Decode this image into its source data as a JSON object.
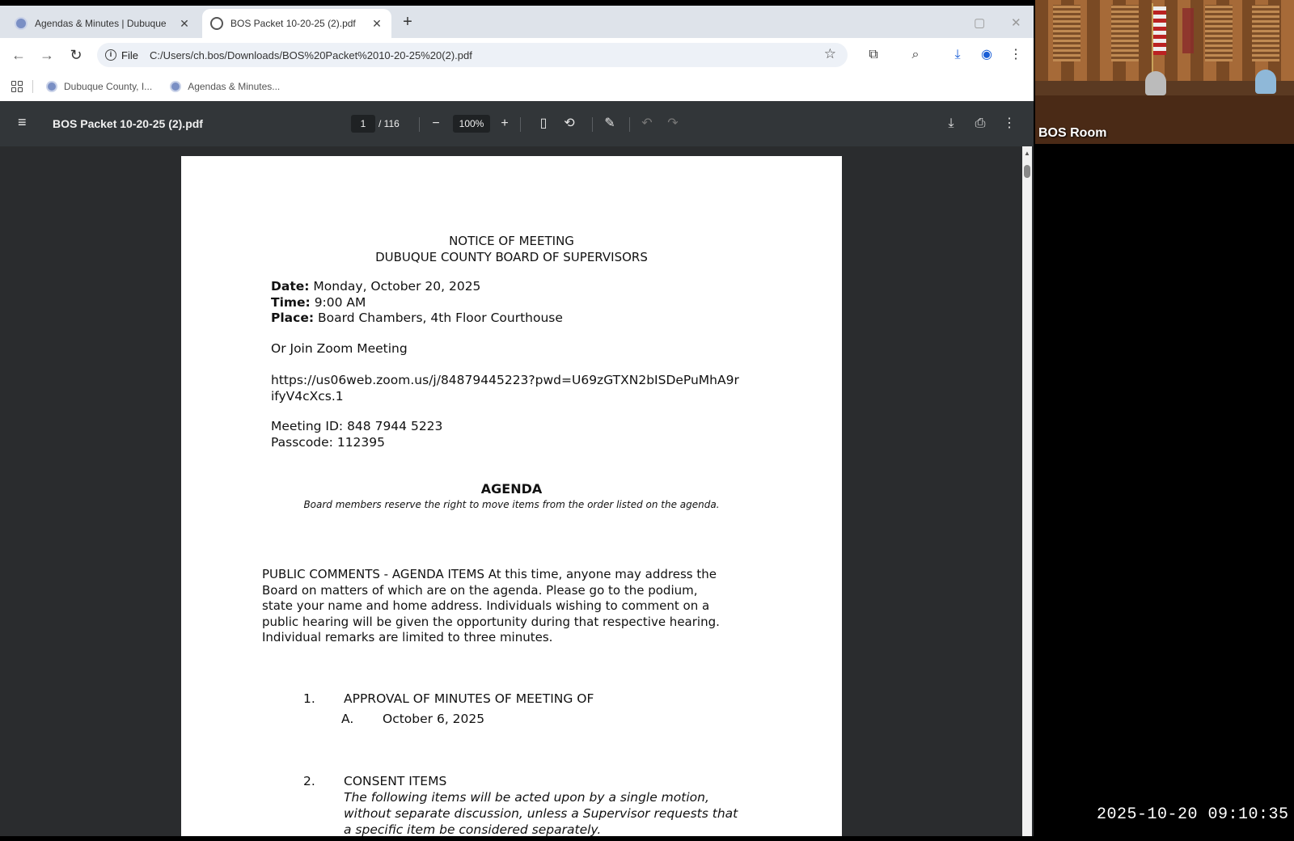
{
  "tabs": [
    {
      "title": "Agendas & Minutes | Dubuque",
      "close": "✕"
    },
    {
      "title": "BOS Packet 10-20-25 (2).pdf",
      "close": "✕"
    }
  ],
  "newtab": "+",
  "window": {
    "minimize": "▢",
    "close": "✕"
  },
  "nav": {
    "back": "←",
    "forward": "→",
    "reload": "↻"
  },
  "omnibox": {
    "info": "i",
    "scheme": "File",
    "url": "C:/Users/ch.bos/Downloads/BOS%20Packet%2010-20-25%20(2).pdf",
    "star": "☆"
  },
  "toolbar_icons": {
    "extensions": "⧉",
    "lens": "⌕",
    "download": "⤓",
    "profile": "◉",
    "menu": "⋮"
  },
  "bookmarks": [
    {
      "label": "Dubuque County, I..."
    },
    {
      "label": "Agendas & Minutes..."
    }
  ],
  "pdf": {
    "menu": "≡",
    "filename": "BOS Packet 10-20-25 (2).pdf",
    "page": "1",
    "total": "/ 116",
    "zoom_out": "−",
    "zoom": "100%",
    "zoom_in": "+",
    "fit": "▯",
    "rotate": "⟲",
    "annotate": "✎",
    "undo": "↶",
    "redo": "↷",
    "download": "⤓",
    "print": "⎙",
    "more": "⋮"
  },
  "document": {
    "heading1": "NOTICE OF MEETING",
    "heading2": "DUBUQUE COUNTY BOARD OF SUPERVISORS",
    "date_label": "Date:",
    "date_value": "Monday, October 20, 2025",
    "time_label": "Time:",
    "time_value": "9:00 AM",
    "place_label": "Place:",
    "place_value": "Board Chambers, 4th Floor Courthouse",
    "zoom_join": "Or Join Zoom Meeting",
    "zoom_link_1": "https://us06web.zoom.us/j/84879445223?pwd=U69zGTXN2bISDePuMhA9r",
    "zoom_link_2": "ifyV4cXcs.1",
    "meeting_id": "Meeting ID: 848 7944 5223",
    "passcode": "Passcode: 112395",
    "agenda_title": "AGENDA",
    "agenda_note": "Board members reserve the right to move items from the order listed on the agenda.",
    "public_comments": [
      "PUBLIC COMMENTS - AGENDA ITEMS At this time, anyone may address the",
      "Board on matters of which are on the agenda. Please go to the podium,",
      "state your name and home address. Individuals wishing to comment on a",
      "public hearing will be given the opportunity during that respective hearing.",
      "Individual remarks are limited to three minutes."
    ],
    "item1_num": "1.",
    "item1_title": "APPROVAL OF MINUTES OF MEETING OF",
    "item1a_letter": "A.",
    "item1a_value": "October 6, 2025",
    "item2_num": "2.",
    "item2_title": "CONSENT ITEMS",
    "item2_text": [
      "The following items will be acted upon by a single motion,",
      "without separate discussion, unless a Supervisor requests that",
      "a specific item be considered separately."
    ]
  },
  "camera": {
    "label": "BOS Room"
  },
  "timestamp": "2025-10-20 09:10:35"
}
